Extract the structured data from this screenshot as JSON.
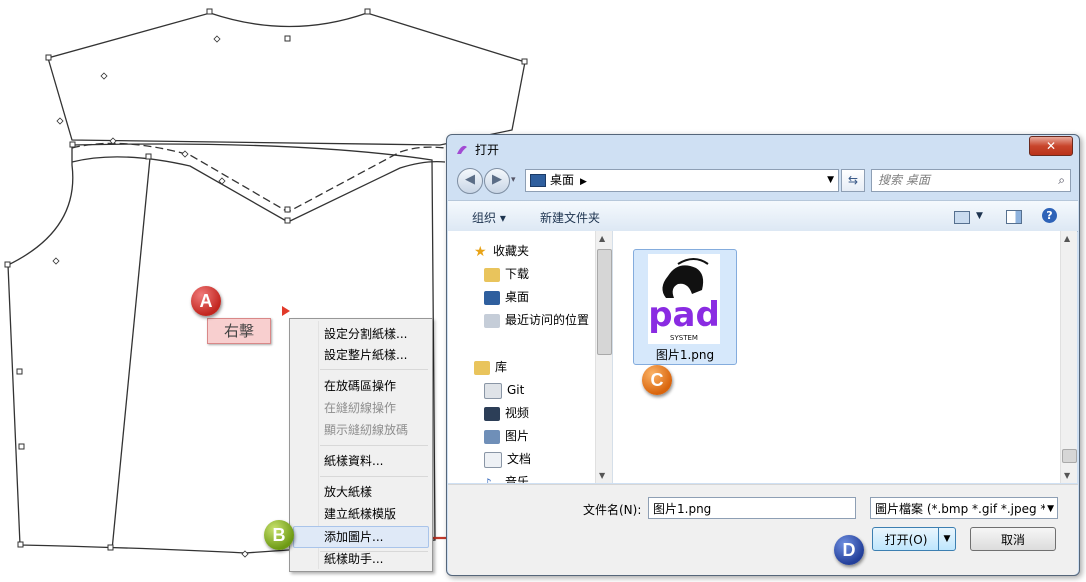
{
  "annotations": {
    "right_click_label": "右擊",
    "markers": [
      "A",
      "B",
      "C",
      "D"
    ]
  },
  "context_menu": {
    "items": [
      {
        "label": "設定分割紙樣...",
        "enabled": true
      },
      {
        "label": "設定整片紙樣...",
        "enabled": true
      },
      {
        "label": "在放碼區操作",
        "enabled": true
      },
      {
        "label": "在縫紉線操作",
        "enabled": false
      },
      {
        "label": "顯示縫紉線放碼",
        "enabled": false
      },
      {
        "label": "紙樣資料...",
        "enabled": true
      },
      {
        "label": "放大紙樣",
        "enabled": true
      },
      {
        "label": "建立紙樣模版",
        "enabled": true
      },
      {
        "label": "添加圖片...",
        "enabled": true,
        "highlighted": true
      },
      {
        "label": "紙樣助手...",
        "enabled": true
      }
    ]
  },
  "dialog": {
    "title": "打开",
    "close_label": "✕",
    "address": "桌面",
    "search_placeholder": "搜索 桌面",
    "toolbar": {
      "organize": "组织 ▾",
      "new_folder": "新建文件夹"
    },
    "nav": {
      "favorites": "收藏夹",
      "fav_items": [
        "下载",
        "桌面",
        "最近访问的位置"
      ],
      "libraries": "库",
      "lib_items": [
        "Git",
        "视频",
        "图片",
        "文档",
        "音乐"
      ]
    },
    "file": {
      "name": "图片1.png",
      "logo_text": "pad",
      "logo_subtext": "SYSTEM"
    },
    "footer": {
      "filename_label": "文件名(N):",
      "filename_value": "图片1.png",
      "filetype": "圖片檔案 (*.bmp *.gif *.jpeg *",
      "open_button": "打开(O)",
      "cancel_button": "取消"
    }
  },
  "colors": {
    "arrow": "#c0392b",
    "dialog_frame": "#cfe0f3",
    "selection": "#d6e8fb"
  }
}
